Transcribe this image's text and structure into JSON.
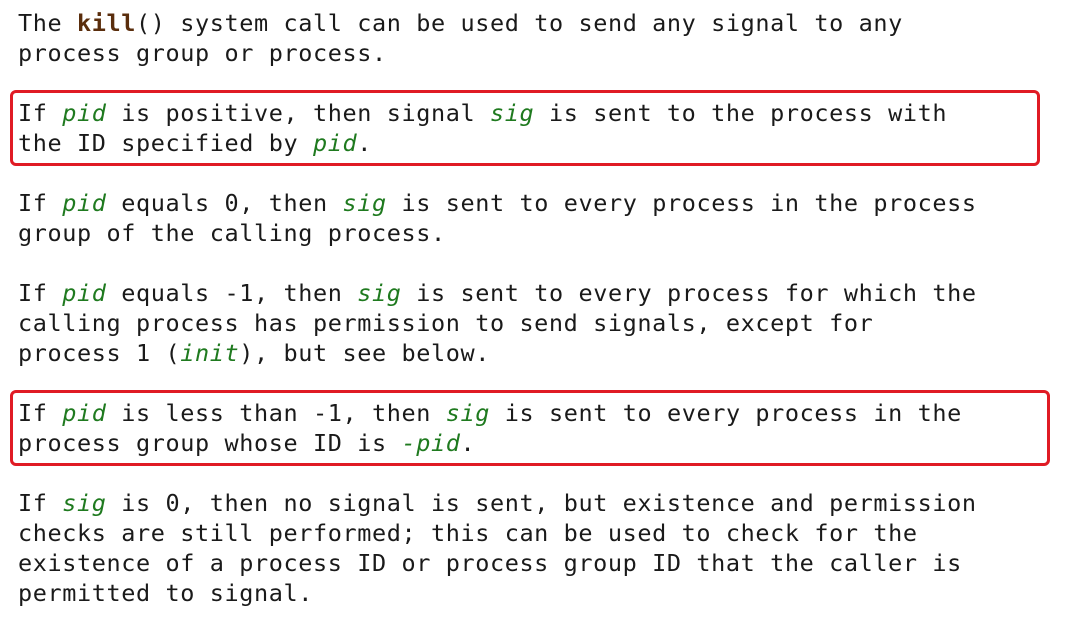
{
  "intro": {
    "prefix": "The ",
    "func": "kill",
    "suffix_line1": "() system call can be used to send any signal to any",
    "line2": "process group or process."
  },
  "p1": {
    "a": "If ",
    "pid": "pid",
    "b": " is positive, then signal ",
    "sig": "sig",
    "c": " is sent to the process with",
    "d": "the ID specified by ",
    "pid2": "pid",
    "e": "."
  },
  "p2": {
    "a": "If ",
    "pid": "pid",
    "b": " equals 0, then ",
    "sig": "sig",
    "c": " is sent to every process in the process",
    "d": "group of the calling process."
  },
  "p3": {
    "a": "If ",
    "pid": "pid",
    "b": " equals -1, then ",
    "sig": "sig",
    "c": " is sent to every process for which the",
    "d": "calling process has permission to send signals, except for",
    "e": "process 1 (",
    "init": "init",
    "f": "), but see below."
  },
  "p4": {
    "a": "If ",
    "pid": "pid",
    "b": " is less than -1, then ",
    "sig": "sig",
    "c": " is sent to every process in the",
    "d": "process group whose ID is ",
    "negpid": "-pid",
    "e": "."
  },
  "p5": {
    "a": "If ",
    "sig": "sig",
    "b": " is 0, then no signal is sent, but existence and permission",
    "c": "checks are still performed; this can be used to check for the",
    "d": "existence of a process ID or process group ID that the caller is",
    "e": "permitted to signal."
  },
  "colors": {
    "highlight": "#e01b24",
    "argument": "#1f7a1f",
    "function": "#5a2d0c"
  }
}
